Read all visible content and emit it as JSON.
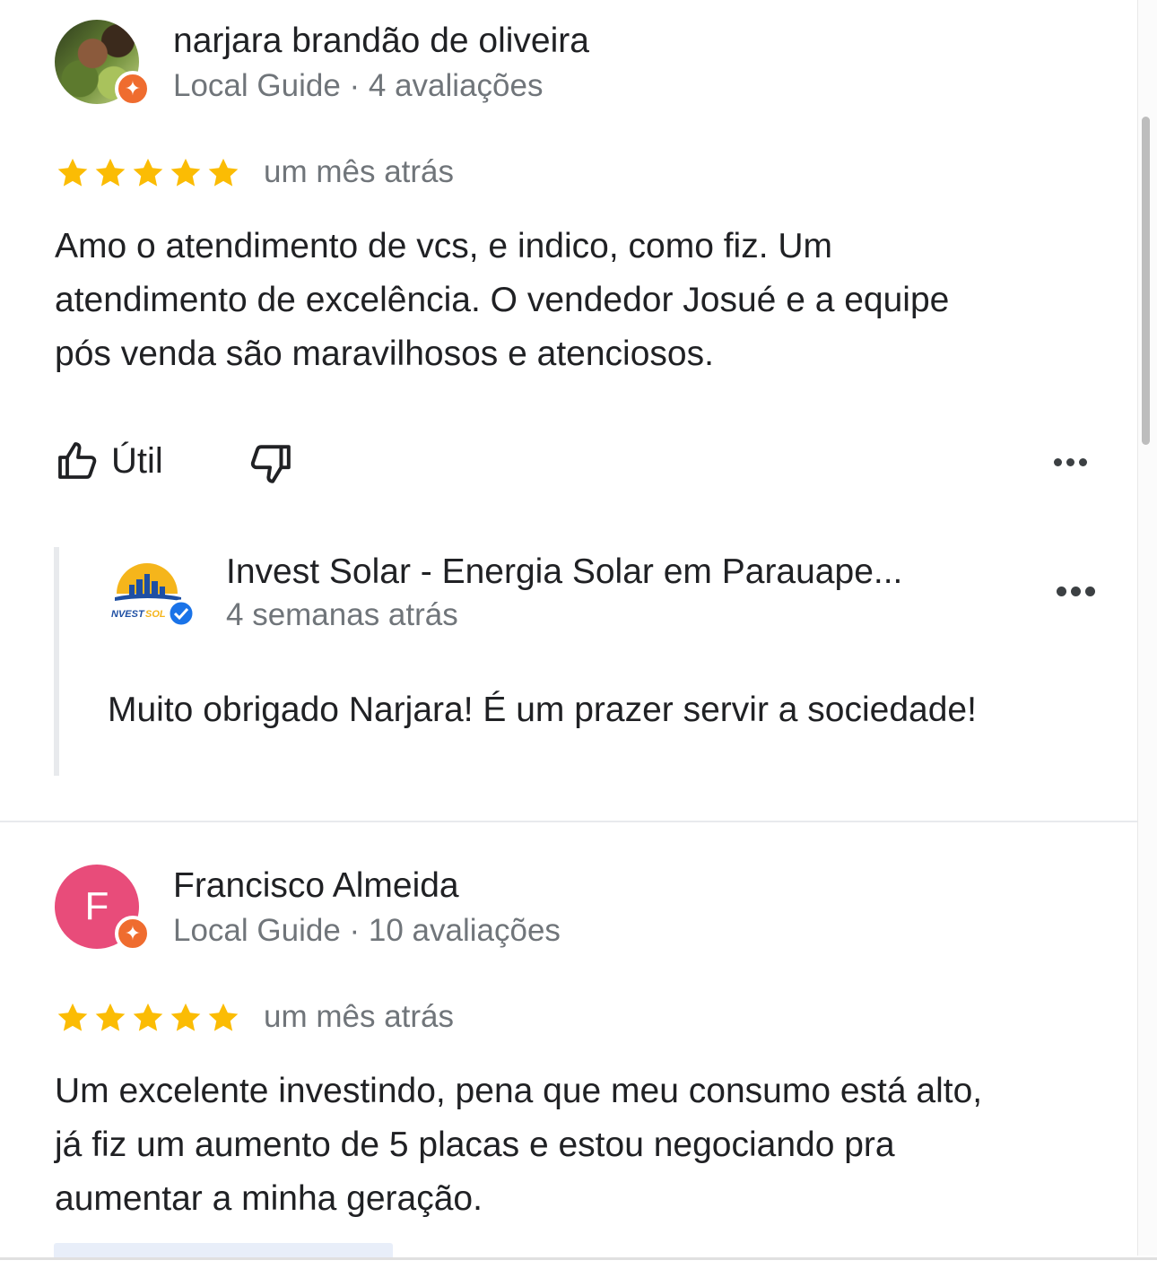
{
  "reviews": [
    {
      "name": "narjara brandão de oliveira",
      "meta": "Local Guide · 4 avaliações",
      "rating": 5,
      "time": "um mês atrás",
      "text_lines": [
        "Amo o atendimento de vcs, e indico, como fiz. Um",
        "atendimento de excelência. O vendedor Josué e a equipe",
        "pós venda são maravilhosos e atenciosos."
      ],
      "helpful_label": "Útil",
      "response": {
        "name": "Invest Solar - Energia Solar em Parauape...",
        "time": "4 semanas atrás",
        "text": "Muito obrigado Narjara! É um prazer servir a sociedade!",
        "logo_text": "NVESTSOL"
      }
    },
    {
      "name": "Francisco Almeida",
      "avatar_letter": "F",
      "meta": "Local Guide · 10 avaliações",
      "rating": 5,
      "time": "um mês atrás",
      "text_lines": [
        "Um excelente investindo, pena que meu consumo está alto,",
        "já fiz um aumento de 5 placas e estou negociando pra",
        "aumentar a minha geração."
      ]
    }
  ],
  "colors": {
    "star": "#FBBC04",
    "guide_badge": "#EF6C2F",
    "avatar_f": "#E84C7A",
    "verified": "#1A73E8",
    "text_secondary": "#70757A"
  }
}
